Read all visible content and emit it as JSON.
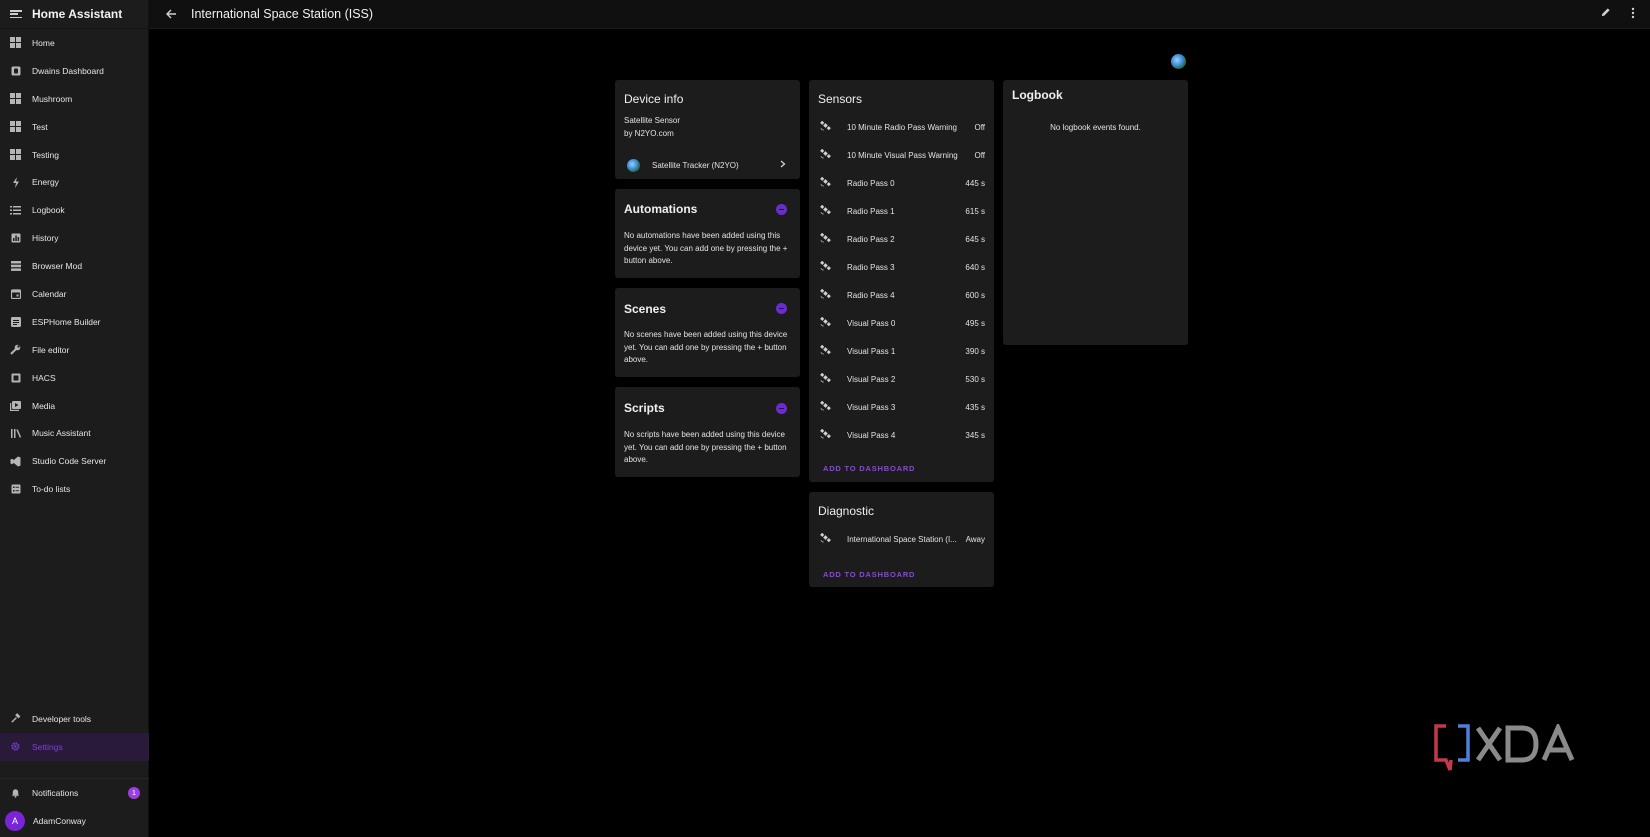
{
  "sidebar": {
    "title": "Home Assistant",
    "items": [
      {
        "label": "Home",
        "icon": "dashboard-icon"
      },
      {
        "label": "Dwains Dashboard",
        "icon": "dwains-icon"
      },
      {
        "label": "Mushroom",
        "icon": "dashboard-icon"
      },
      {
        "label": "Test",
        "icon": "dashboard-icon"
      },
      {
        "label": "Testing",
        "icon": "dashboard-icon"
      },
      {
        "label": "Energy",
        "icon": "lightning-icon"
      },
      {
        "label": "Logbook",
        "icon": "list-icon"
      },
      {
        "label": "History",
        "icon": "chart-icon"
      },
      {
        "label": "Browser Mod",
        "icon": "server-icon"
      },
      {
        "label": "Calendar",
        "icon": "calendar-icon"
      },
      {
        "label": "ESPHome Builder",
        "icon": "esphome-icon"
      },
      {
        "label": "File editor",
        "icon": "wrench-icon"
      },
      {
        "label": "HACS",
        "icon": "hacs-icon"
      },
      {
        "label": "Media",
        "icon": "media-icon"
      },
      {
        "label": "Music Assistant",
        "icon": "music-icon"
      },
      {
        "label": "Studio Code Server",
        "icon": "vscode-icon"
      },
      {
        "label": "To-do lists",
        "icon": "todo-icon"
      }
    ],
    "developer_tools": "Developer tools",
    "settings": "Settings",
    "notifications": "Notifications",
    "notifications_count": "1",
    "user": "AdamConway",
    "user_initial": "A"
  },
  "topbar": {
    "title": "International Space Station (ISS)"
  },
  "device_info": {
    "title": "Device info",
    "model": "Satellite Sensor",
    "manufacturer": "by N2YO.com",
    "integration": "Satellite Tracker (N2YO)"
  },
  "automations": {
    "title": "Automations",
    "text": "No automations have been added using this device yet. You can add one by pressing the + button above."
  },
  "scenes": {
    "title": "Scenes",
    "text": "No scenes have been added using this device yet. You can add one by pressing the + button above."
  },
  "scripts": {
    "title": "Scripts",
    "text": "No scripts have been added using this device yet. You can add one by pressing the + button above."
  },
  "sensors": {
    "title": "Sensors",
    "rows": [
      {
        "name": "10 Minute Radio Pass Warning",
        "value": "Off"
      },
      {
        "name": "10 Minute Visual Pass Warning",
        "value": "Off"
      },
      {
        "name": "Radio Pass 0",
        "value": "445 s"
      },
      {
        "name": "Radio Pass 1",
        "value": "615 s"
      },
      {
        "name": "Radio Pass 2",
        "value": "645 s"
      },
      {
        "name": "Radio Pass 3",
        "value": "640 s"
      },
      {
        "name": "Radio Pass 4",
        "value": "600 s"
      },
      {
        "name": "Visual Pass 0",
        "value": "495 s"
      },
      {
        "name": "Visual Pass 1",
        "value": "390 s"
      },
      {
        "name": "Visual Pass 2",
        "value": "530 s"
      },
      {
        "name": "Visual Pass 3",
        "value": "435 s"
      },
      {
        "name": "Visual Pass 4",
        "value": "345 s"
      }
    ],
    "add_label": "ADD TO DASHBOARD"
  },
  "diagnostic": {
    "title": "Diagnostic",
    "rows": [
      {
        "name": "International Space Station (I...",
        "value": "Away"
      }
    ],
    "add_label": "ADD TO DASHBOARD"
  },
  "logbook": {
    "title": "Logbook",
    "empty": "No logbook events found."
  },
  "watermark": "XDA",
  "colors": {
    "accent": "#8b44e8",
    "card": "#1c1c1c",
    "sidebar": "#1c1c1c",
    "background": "#000000"
  }
}
